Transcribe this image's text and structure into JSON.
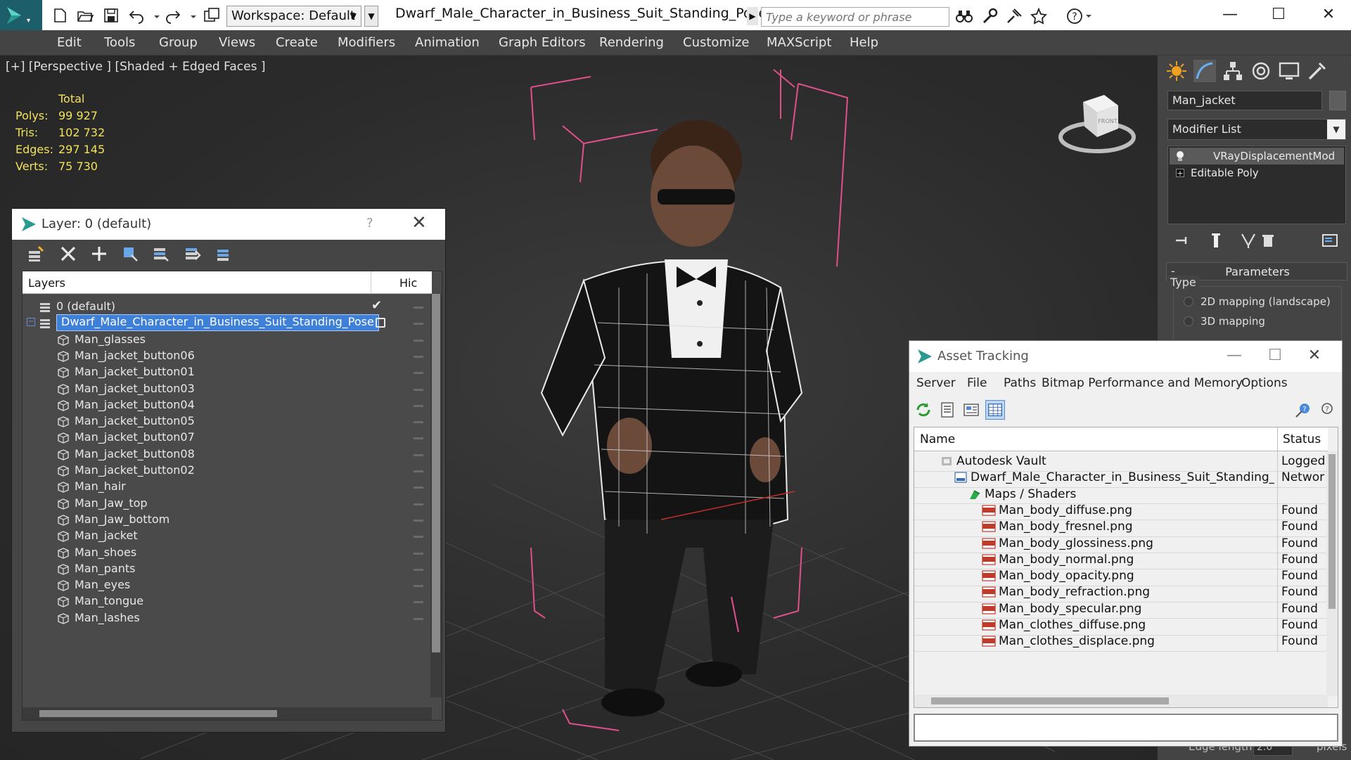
{
  "titlebar": {
    "workspace": "Workspace: Default",
    "window_title": "Dwarf_Male_Character_in_Business_Suit_Standing_Pose_max_...",
    "search_placeholder": "Type a keyword or phrase",
    "minimize": "—",
    "maximize": "☐",
    "close": "✕"
  },
  "menubar": [
    "Edit",
    "Tools",
    "Group",
    "Views",
    "Create",
    "Modifiers",
    "Animation",
    "Graph Editors",
    "Rendering",
    "Customize",
    "MAXScript",
    "Help"
  ],
  "viewport": {
    "label": "[+] [Perspective ] [Shaded + Edged Faces ]",
    "stats": {
      "header": "Total",
      "rows": [
        {
          "label": "Polys:",
          "value": "99 927"
        },
        {
          "label": "Tris:",
          "value": "102 732"
        },
        {
          "label": "Edges:",
          "value": "297 145"
        },
        {
          "label": "Verts:",
          "value": "75 730"
        }
      ]
    },
    "viewcube_face": "FRONT"
  },
  "layer_dialog": {
    "title": "Layer: 0 (default)",
    "help": "?",
    "close": "✕",
    "col_layers": "Layers",
    "col_hide": "Hic",
    "rows": [
      {
        "name": "0 (default)",
        "level": 0,
        "kind": "layer",
        "checked": true
      },
      {
        "name": "Dwarf_Male_Character_in_Business_Suit_Standing_Pose",
        "level": 0,
        "kind": "layer",
        "selected": true
      },
      {
        "name": "Man_glasses",
        "level": 1,
        "kind": "object"
      },
      {
        "name": "Man_jacket_button06",
        "level": 1,
        "kind": "object"
      },
      {
        "name": "Man_jacket_button01",
        "level": 1,
        "kind": "object"
      },
      {
        "name": "Man_jacket_button03",
        "level": 1,
        "kind": "object"
      },
      {
        "name": "Man_jacket_button04",
        "level": 1,
        "kind": "object"
      },
      {
        "name": "Man_jacket_button05",
        "level": 1,
        "kind": "object"
      },
      {
        "name": "Man_jacket_button07",
        "level": 1,
        "kind": "object"
      },
      {
        "name": "Man_jacket_button08",
        "level": 1,
        "kind": "object"
      },
      {
        "name": "Man_jacket_button02",
        "level": 1,
        "kind": "object"
      },
      {
        "name": "Man_hair",
        "level": 1,
        "kind": "object"
      },
      {
        "name": "Man_Jaw_top",
        "level": 1,
        "kind": "object"
      },
      {
        "name": "Man_Jaw_bottom",
        "level": 1,
        "kind": "object"
      },
      {
        "name": "Man_jacket",
        "level": 1,
        "kind": "object"
      },
      {
        "name": "Man_shoes",
        "level": 1,
        "kind": "object"
      },
      {
        "name": "Man_pants",
        "level": 1,
        "kind": "object"
      },
      {
        "name": "Man_eyes",
        "level": 1,
        "kind": "object"
      },
      {
        "name": "Man_tongue",
        "level": 1,
        "kind": "object"
      },
      {
        "name": "Man_lashes",
        "level": 1,
        "kind": "object"
      }
    ]
  },
  "command_panel": {
    "object_name": "Man_jacket",
    "modifier_list": "Modifier List",
    "stack": [
      {
        "name": "VRayDisplacementMod",
        "active": true
      },
      {
        "name": "Editable Poly",
        "active": false
      }
    ],
    "params_collapse": "-",
    "params_title": "Parameters",
    "type_label": "Type",
    "type_options": [
      "2D mapping (landscape)",
      "3D mapping"
    ],
    "edge_length_label": "Edge length",
    "edge_length_value": "2.0",
    "edge_pixels_label": "pixels"
  },
  "asset_dialog": {
    "title": "Asset Tracking",
    "menu": [
      "Server",
      "File",
      "Paths",
      "Bitmap Performance and Memory",
      "Options"
    ],
    "col_name": "Name",
    "col_status": "Status",
    "rows": [
      {
        "name": "Autodesk Vault",
        "status": "Logged",
        "level": 0,
        "icon": "vault"
      },
      {
        "name": "Dwarf_Male_Character_in_Business_Suit_Standing_P...",
        "status": "Networ",
        "level": 1,
        "icon": "max"
      },
      {
        "name": "Maps / Shaders",
        "status": "",
        "level": 2,
        "icon": "maps"
      },
      {
        "name": "Man_body_diffuse.png",
        "status": "Found",
        "level": 3,
        "icon": "png"
      },
      {
        "name": "Man_body_fresnel.png",
        "status": "Found",
        "level": 3,
        "icon": "png"
      },
      {
        "name": "Man_body_glossiness.png",
        "status": "Found",
        "level": 3,
        "icon": "png"
      },
      {
        "name": "Man_body_normal.png",
        "status": "Found",
        "level": 3,
        "icon": "png"
      },
      {
        "name": "Man_body_opacity.png",
        "status": "Found",
        "level": 3,
        "icon": "png"
      },
      {
        "name": "Man_body_refraction.png",
        "status": "Found",
        "level": 3,
        "icon": "png"
      },
      {
        "name": "Man_body_specular.png",
        "status": "Found",
        "level": 3,
        "icon": "png"
      },
      {
        "name": "Man_clothes_diffuse.png",
        "status": "Found",
        "level": 3,
        "icon": "png"
      },
      {
        "name": "Man_clothes_displace.png",
        "status": "Found",
        "level": 3,
        "icon": "png"
      }
    ]
  },
  "colors": {
    "accent_selected": "#3e7fd8",
    "stats_text": "#f2e25a",
    "selection_box": "#e0508a",
    "logo_teal": "#1c5f6a"
  }
}
